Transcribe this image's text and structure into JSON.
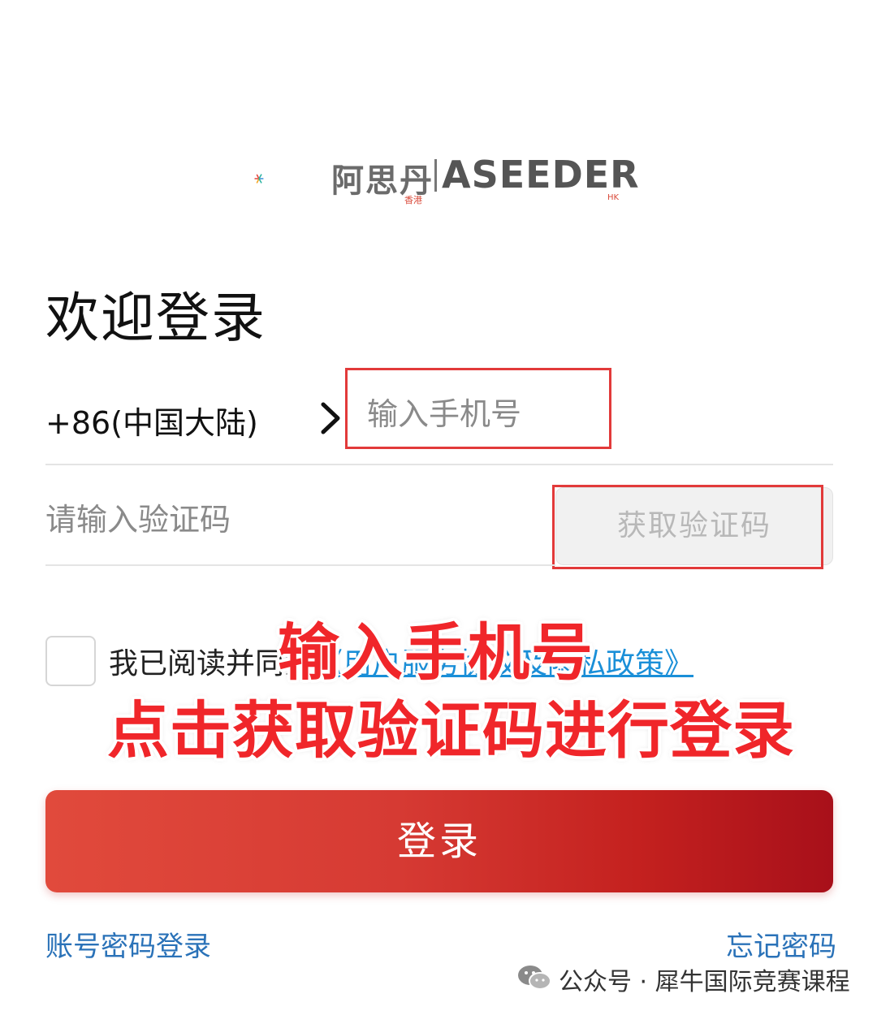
{
  "logo": {
    "cn_name": "阿思丹",
    "cn_sub": "香港",
    "en_name": "ASEEDER",
    "en_sub": "HK",
    "colors": [
      "#e8433a",
      "#f5a623",
      "#2bb3a3",
      "#3a8fd8"
    ]
  },
  "page_title": "欢迎登录",
  "phone": {
    "country_code": "+86(中国大陆)",
    "placeholder": "输入手机号"
  },
  "code": {
    "placeholder": "请输入验证码",
    "get_code_label": "获取验证码"
  },
  "agreement": {
    "prefix": "我已阅读并同意",
    "link": "《用户服务协议及隐私政策》"
  },
  "annotation": {
    "line1": "输入手机号",
    "line2": "点击获取验证码进行登录"
  },
  "login_button": "登录",
  "footer": {
    "account_login": "账号密码登录",
    "forgot_password": "忘记密码"
  },
  "watermark": "公众号 · 犀牛国际竞赛课程",
  "colors": {
    "accent": "#d63a33",
    "link": "#2a72b8",
    "highlight": "#e23a3a"
  }
}
